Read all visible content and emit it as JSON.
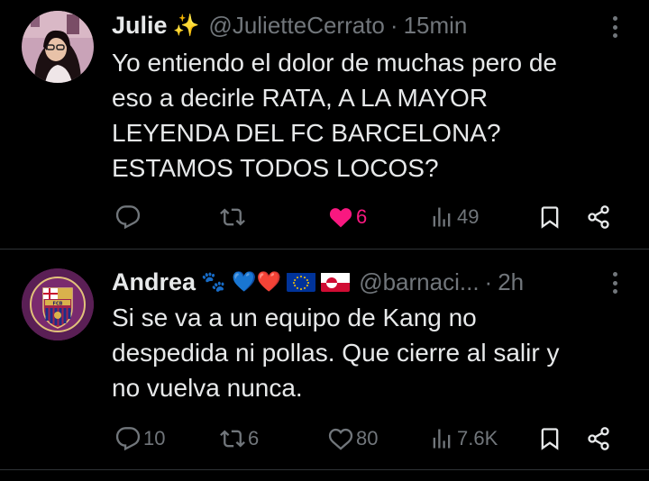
{
  "tweets": [
    {
      "author_name": "Julie",
      "author_emoji": "✨",
      "handle": "@JulietteCerrato",
      "separator": "·",
      "time": "15min",
      "text": "Yo entiendo el dolor de muchas pero de\neso a decirle RATA, A LA MAYOR\nLEYENDA DEL FC BARCELONA?\nESTAMOS TODOS LOCOS?",
      "replies": "",
      "retweets": "",
      "likes": "6",
      "views": "49",
      "liked": true
    },
    {
      "author_name": "Andrea",
      "author_emoji": "🐾 💙❤️",
      "handle": "@barnaci...",
      "separator": "·",
      "time": "2h",
      "text": "Si se va a un equipo de Kang no\ndespedida ni pollas. Que cierre al salir y\nno vuelva nunca.",
      "replies": "10",
      "retweets": "6",
      "likes": "80",
      "views": "7.6K",
      "liked": false
    }
  ],
  "avatar2_text": "FCB",
  "colors": {
    "background": "#000000",
    "text": "#e7e9ea",
    "muted": "#71767b",
    "like_active": "#f91880",
    "divider": "#2f3336"
  },
  "icons": [
    "reply-icon",
    "retweet-icon",
    "like-icon",
    "views-icon",
    "bookmark-icon",
    "share-icon",
    "more-icon"
  ]
}
